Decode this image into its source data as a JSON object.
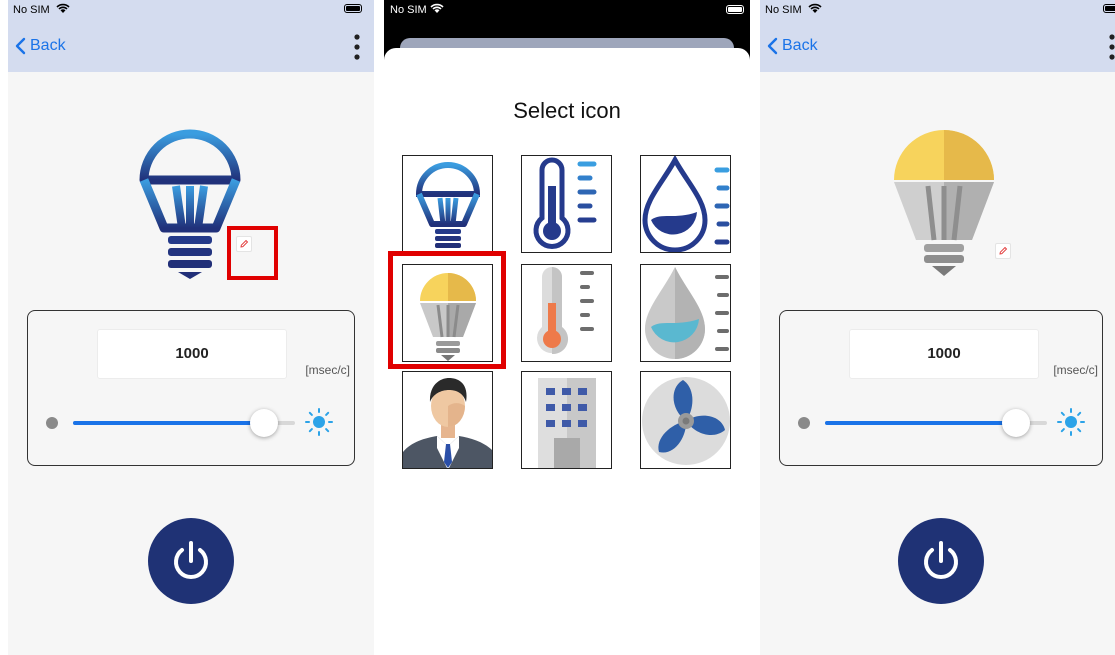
{
  "status": {
    "carrier": "No SIM"
  },
  "nav": {
    "back_label": "Back"
  },
  "control": {
    "interval_value": "1000",
    "unit": "[msec/c]",
    "slider_fraction": 0.86
  },
  "picker": {
    "title": "Select icon",
    "icons": [
      "lightbulb-blue-icon",
      "thermometer-blue-icon",
      "water-drop-blue-icon",
      "lightbulb-yellow-icon",
      "thermometer-color-icon",
      "water-drop-color-icon",
      "businessman-icon",
      "office-building-icon",
      "fan-icon"
    ],
    "selected_index": 3
  },
  "colors": {
    "accent": "#1a73e8",
    "nav_bg": "#d4dcef",
    "power": "#1f3275",
    "highlight": "#e00000",
    "bulb_yellow": "#f7d35c"
  }
}
